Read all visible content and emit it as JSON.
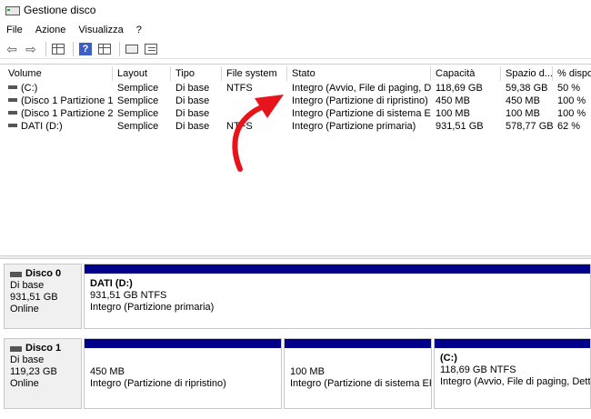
{
  "window": {
    "title": "Gestione disco"
  },
  "menu": [
    "File",
    "Azione",
    "Visualizza",
    "?"
  ],
  "toolbar": {
    "icons": [
      "back-arrow-icon",
      "forward-arrow-icon",
      "list-view-icon",
      "help-icon",
      "disk-view-icon",
      "rescan-icon",
      "properties-icon"
    ],
    "help_glyph": "?"
  },
  "table": {
    "columns": [
      "Volume",
      "Layout",
      "Tipo",
      "File system",
      "Stato",
      "Capacità",
      "Spazio d...",
      "% dispon"
    ],
    "rows": [
      [
        "(C:)",
        "Semplice",
        "Di base",
        "NTFS",
        "Integro (Avvio, File di paging, D...",
        "118,69 GB",
        "59,38 GB",
        "50 %"
      ],
      [
        "(Disco 1 Partizione 1)",
        "Semplice",
        "Di base",
        "",
        "Integro (Partizione di ripristino)",
        "450 MB",
        "450 MB",
        "100 %"
      ],
      [
        "(Disco 1 Partizione 2)",
        "Semplice",
        "Di base",
        "",
        "Integro (Partizione di sistema EFI)",
        "100 MB",
        "100 MB",
        "100 %"
      ],
      [
        "DATI (D:)",
        "Semplice",
        "Di base",
        "NTFS",
        "Integro (Partizione primaria)",
        "931,51 GB",
        "578,77 GB",
        "62 %"
      ]
    ]
  },
  "annotation": {
    "color": "#e8141b"
  },
  "disks": [
    {
      "name": "Disco 0",
      "type": "Di base",
      "size": "931,51 GB",
      "status": "Online",
      "partitions": [
        {
          "name": "DATI  (D:)",
          "size": "931,51 GB NTFS",
          "status": "Integro (Partizione primaria)"
        }
      ]
    },
    {
      "name": "Disco 1",
      "type": "Di base",
      "size": "119,23 GB",
      "status": "Online",
      "partitions": [
        {
          "name": "",
          "size": "450 MB",
          "status": "Integro (Partizione di ripristino)"
        },
        {
          "name": "",
          "size": "100 MB",
          "status": "Integro (Partizione di sistema EFI)"
        },
        {
          "name": "(C:)",
          "size": "118,69 GB NTFS",
          "status": "Integro (Avvio, File di paging, Dettagli"
        }
      ]
    }
  ],
  "colors": {
    "partition_bar": "#00008b",
    "label_bg": "#f0f0f0"
  }
}
